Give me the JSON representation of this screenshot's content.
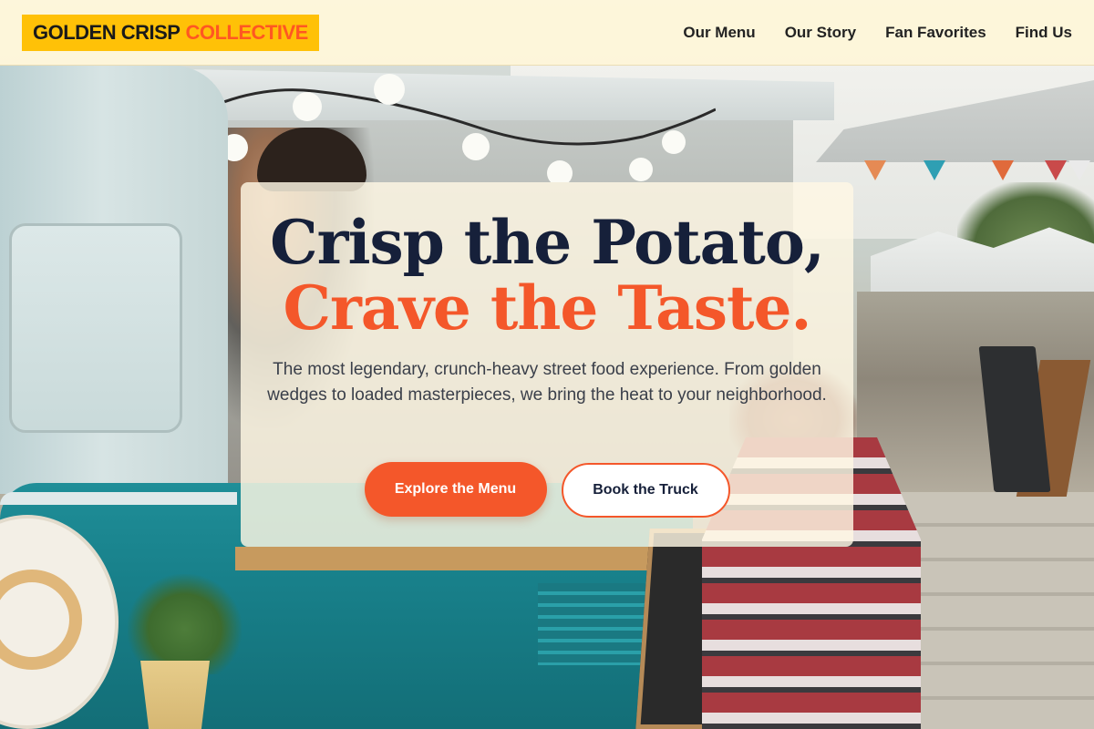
{
  "header": {
    "brand_part1": "GOLDEN CRISP",
    "brand_part2": "COLLECTIVE",
    "nav": [
      {
        "label": "Our Menu"
      },
      {
        "label": "Our Story"
      },
      {
        "label": "Fan Favorites"
      },
      {
        "label": "Find Us"
      }
    ]
  },
  "hero": {
    "headline_line1": "Crisp the Potato,",
    "headline_line2": "Crave the Taste.",
    "subtext": "The most legendary, crunch-heavy street food experience. From golden wedges to loaded masterpieces, we bring the heat to your neighborhood.",
    "primary_button": "Explore the Menu",
    "secondary_button": "Book the Truck"
  },
  "colors": {
    "brand_yellow": "#ffc107",
    "accent_orange": "#f4572a",
    "navy_text": "#16203a",
    "header_bg": "#fff7da"
  },
  "background": {
    "icon": "food-truck-photo"
  }
}
